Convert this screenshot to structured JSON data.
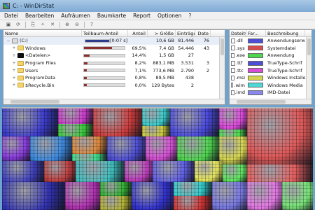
{
  "window": {
    "title": "C: - WinDirStat"
  },
  "menu": [
    "Datei",
    "Bearbeiten",
    "Aufräumen",
    "Baumkarte",
    "Report",
    "Optionen",
    "?"
  ],
  "tree": {
    "columns": [
      "Name",
      "Teilbaum-Anteil",
      "Anteil",
      "> Größe",
      "Einträge",
      "Date"
    ],
    "rows": [
      {
        "name": "(C:)",
        "share": "[0:07 s]",
        "pct": "",
        "size": "10,6 GB",
        "items": "81.446",
        "files": "76",
        "bar": 1.0,
        "icon": "drive",
        "exp": "−",
        "bar_color": "#2e3a8c"
      },
      {
        "name": "Windows",
        "share": "",
        "pct": "69,5%",
        "size": "7,4 GB",
        "items": "54.446",
        "files": "43",
        "bar": 0.695,
        "icon": "folder",
        "exp": "+",
        "bar_color": "#8c2f2f"
      },
      {
        "name": "<Dateien>",
        "share": "",
        "pct": "14,4%",
        "size": "1,5 GB",
        "items": "27",
        "files": "",
        "bar": 0.144,
        "icon": "black",
        "exp": "+",
        "bar_color": "#8c2f2f"
      },
      {
        "name": "Program Files",
        "share": "",
        "pct": "8,2%",
        "size": "883,1 MB",
        "items": "3.531",
        "files": "3",
        "bar": 0.082,
        "icon": "folder",
        "exp": "+",
        "bar_color": "#8c2f2f"
      },
      {
        "name": "Users",
        "share": "",
        "pct": "7,1%",
        "size": "773,6 MB",
        "items": "2.790",
        "files": "2",
        "bar": 0.071,
        "icon": "folder",
        "exp": "+",
        "bar_color": "#8c2f2f"
      },
      {
        "name": "ProgramData",
        "share": "",
        "pct": "0,8%",
        "size": "89,5 MB",
        "items": "438",
        "files": "",
        "bar": 0.008,
        "icon": "folder",
        "exp": "+",
        "bar_color": "#8c2f2f"
      },
      {
        "name": "$Recycle.Bin",
        "share": "",
        "pct": "0,0%",
        "size": "129 Bytes",
        "items": "2",
        "files": "",
        "bar": 0.0,
        "icon": "folder",
        "exp": "+",
        "bar_color": "#8c2f2f"
      }
    ]
  },
  "types": {
    "columns": [
      "Dateityp",
      "Far...",
      "Beschreibung"
    ],
    "rows": [
      {
        "ext": ".dll",
        "color": "#4d4dd6",
        "desc": "Anwendungserw"
      },
      {
        "ext": ".sys",
        "color": "#d64d4d",
        "desc": "Systemdatei"
      },
      {
        "ext": ".exe",
        "color": "#4dd64d",
        "desc": "Anwendung"
      },
      {
        "ext": ".ttf",
        "color": "#4d4dd6",
        "desc": "TrueType-Schrif"
      },
      {
        "ext": ".ttc",
        "color": "#d64dd6",
        "desc": "TrueType-Schrif"
      },
      {
        "ext": ".msi",
        "color": "#d6d64d",
        "desc": "Windows Installe"
      },
      {
        "ext": ".wim",
        "color": "#4dd6d6",
        "desc": "Windows Media"
      },
      {
        "ext": ".imd",
        "color": "#8888ee",
        "desc": "IMD-Datei"
      }
    ]
  },
  "toolbar_icons": [
    "open-icon",
    "refresh-icon",
    "copy-icon",
    "cleanup-icon",
    "delete-icon",
    "zoom-in-icon",
    "zoom-out-icon",
    "help-icon"
  ]
}
